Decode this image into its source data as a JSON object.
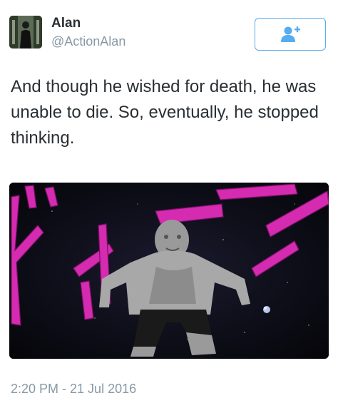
{
  "author": {
    "name": "Alan",
    "handle": "@ActionAlan",
    "avatar_icon": "avatar-figure-icon"
  },
  "follow_button": {
    "icon": "add-user-icon",
    "color": "#55acee"
  },
  "tweet": {
    "text": "And though he wished for death, he was unable to die. So, eventually, he stopped thinking.",
    "timestamp": "2:20 PM - 21 Jul 2016"
  },
  "media": {
    "alt": "stone-figure-in-space-image",
    "accent_color": "#d42bb0"
  }
}
